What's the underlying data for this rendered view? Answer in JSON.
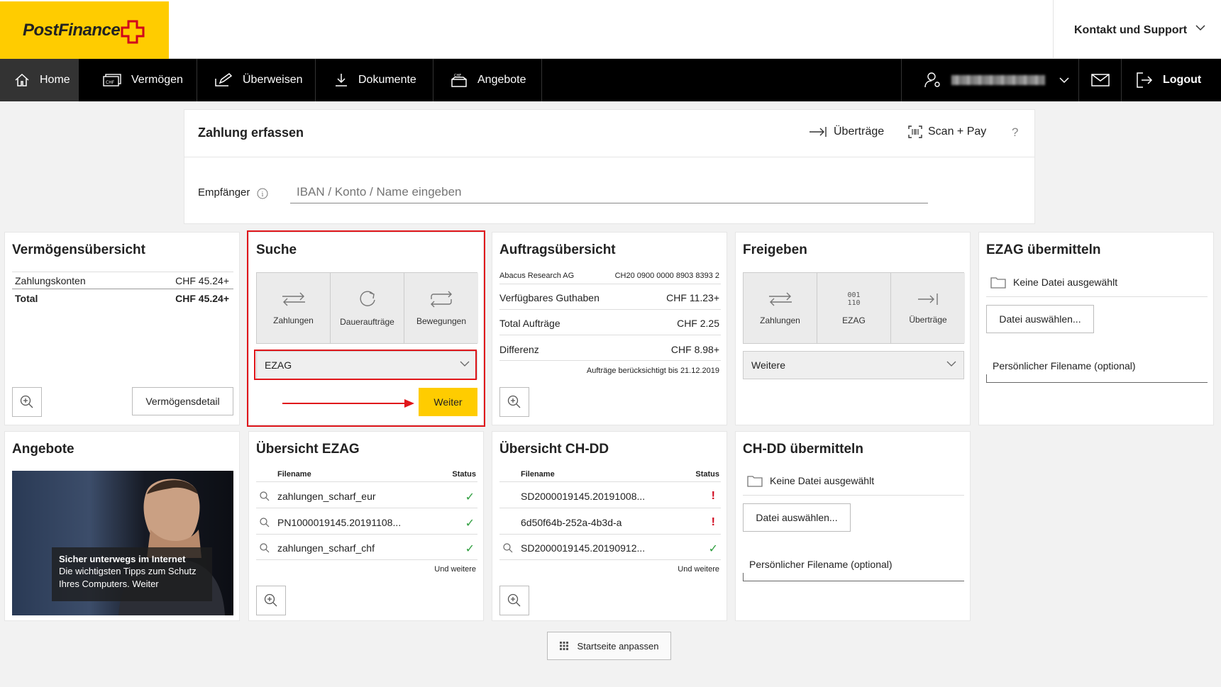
{
  "header": {
    "logo_text": "PostFinance",
    "support_label": "Kontakt und Support"
  },
  "nav": {
    "items": [
      {
        "label": "Home",
        "icon": "home-icon"
      },
      {
        "label": "Vermögen",
        "icon": "chf-card-icon"
      },
      {
        "label": "Überweisen",
        "icon": "edit-icon"
      },
      {
        "label": "Dokumente",
        "icon": "download-icon"
      },
      {
        "label": "Angebote",
        "icon": "offers-icon"
      }
    ],
    "logout_label": "Logout"
  },
  "payment": {
    "title": "Zahlung erfassen",
    "transfers_label": "Überträge",
    "scan_label": "Scan + Pay",
    "help": "?",
    "recipient_label": "Empfänger",
    "recipient_placeholder": "IBAN / Konto / Name eingeben"
  },
  "assets": {
    "title": "Vermögensübersicht",
    "rows": [
      {
        "label": "Zahlungskonten",
        "value": "CHF 45.24+"
      },
      {
        "label": "Total",
        "value": "CHF 45.24+"
      }
    ],
    "detail_button": "Vermögensdetail"
  },
  "search": {
    "title": "Suche",
    "tiles": [
      "Zahlungen",
      "Daueraufträge",
      "Bewegungen"
    ],
    "select_value": "EZAG",
    "next_button": "Weiter"
  },
  "orders": {
    "title": "Auftragsübersicht",
    "account_name": "Abacus Research AG",
    "iban": "CH20 0900 0000 8903 8393 2",
    "rows": [
      {
        "label": "Verfügbares Guthaben",
        "value": "CHF 11.23+"
      },
      {
        "label": "Total Aufträge",
        "value": "CHF 2.25"
      },
      {
        "label": "Differenz",
        "value": "CHF 8.98+"
      }
    ],
    "note": "Aufträge berücksichtigt bis 21.12.2019"
  },
  "release": {
    "title": "Freigeben",
    "tiles": [
      "Zahlungen",
      "EZAG",
      "Überträge"
    ],
    "ezag_icon_text": [
      "001",
      "110"
    ],
    "select_value": "Weitere"
  },
  "ezag_upload": {
    "title": "EZAG übermitteln",
    "no_file": "Keine Datei ausgewählt",
    "choose_button": "Datei auswählen...",
    "filename_label": "Persönlicher Filename (optional)"
  },
  "offers": {
    "title": "Angebote",
    "promo_title": "Sicher unterwegs im Internet",
    "promo_text": "Die wichtigsten Tipps zum Schutz Ihres Computers. Weiter"
  },
  "ezag_overview": {
    "title": "Übersicht EZAG",
    "col_filename": "Filename",
    "col_status": "Status",
    "files": [
      "zahlungen_scharf_eur",
      "PN1000019145.20191108...",
      "zahlungen_scharf_chf"
    ],
    "statuses": [
      "✓",
      "✓",
      "✓"
    ],
    "more": "Und weitere"
  },
  "chdd_overview": {
    "title": "Übersicht CH-DD",
    "col_filename": "Filename",
    "col_status": "Status",
    "files": [
      "SD2000019145.20191008...",
      "6d50f64b-252a-4b3d-a",
      "SD2000019145.20190912..."
    ],
    "statuses": [
      "!",
      "!",
      "✓"
    ],
    "more": "Und weitere"
  },
  "chdd_upload": {
    "title": "CH-DD übermitteln",
    "no_file": "Keine Datei ausgewählt",
    "choose_button": "Datei auswählen...",
    "filename_label": "Persönlicher Filename (optional)"
  },
  "customize_button": "Startseite anpassen",
  "colors": {
    "brand_yellow": "#ffcc00",
    "nav_bg": "#000000",
    "highlight_red": "#e0161b",
    "ok_green": "#2e9e3e",
    "alert_red": "#d0021b"
  }
}
